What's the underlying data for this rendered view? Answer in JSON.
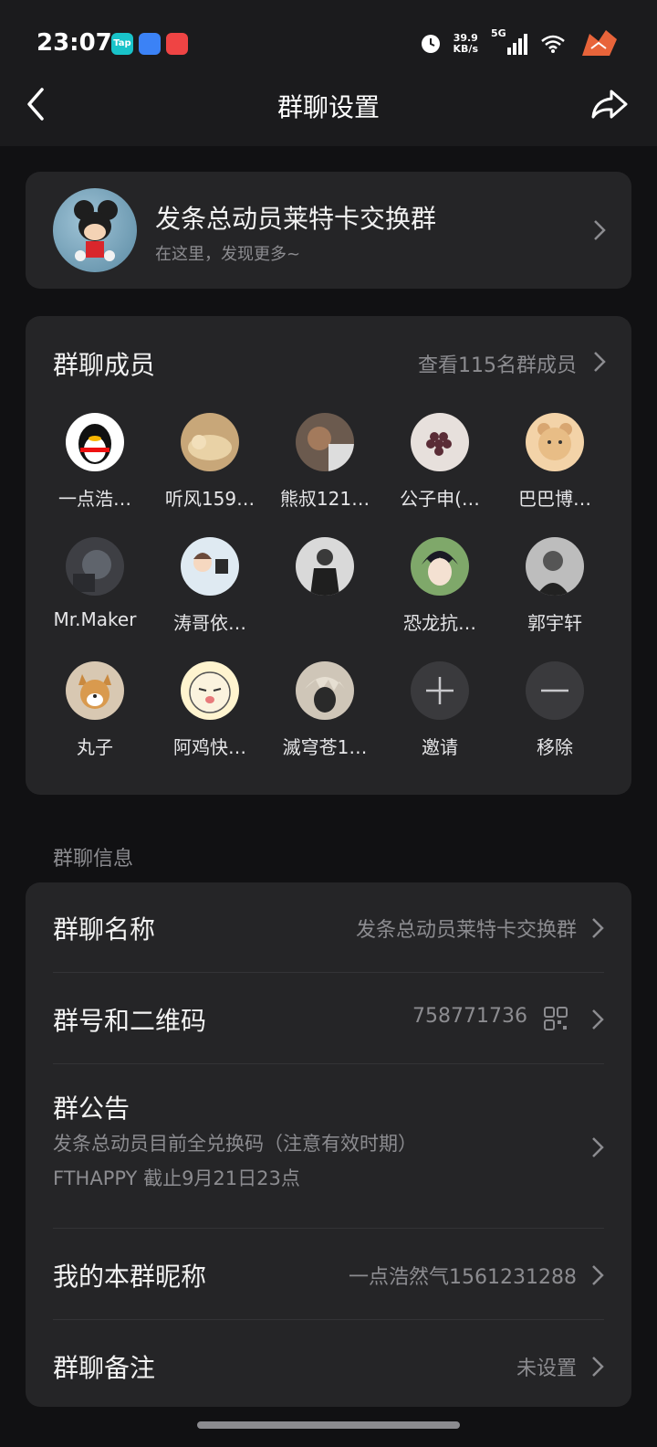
{
  "status_bar": {
    "time": "23:07",
    "apps": [
      {
        "name": "taptap-icon",
        "label": "Tap",
        "color": "#19c3c9"
      },
      {
        "name": "files-icon",
        "label": "",
        "color": "#3b82f6"
      },
      {
        "name": "red-app-icon",
        "label": "",
        "color": "#ef4444"
      }
    ],
    "speed_value": "39.9",
    "speed_unit": "KB/s",
    "network": "5G"
  },
  "nav": {
    "title": "群聊设置"
  },
  "group": {
    "name": "发条总动员莱特卡交换群",
    "subtitle": "在这里，发现更多~"
  },
  "members": {
    "title": "群聊成员",
    "view_all": "查看115名群成员",
    "items": [
      {
        "name": "一点浩…",
        "avatar": "qq-penguin",
        "color": "#ffffff"
      },
      {
        "name": "听风159…",
        "avatar": "sleeping-dog",
        "color": "#c8a779"
      },
      {
        "name": "熊叔121…",
        "avatar": "man-photo",
        "color": "#6b5a4e"
      },
      {
        "name": "公子申(…",
        "avatar": "grape-doodle",
        "color": "#e7e0dc"
      },
      {
        "name": "巴巴博…",
        "avatar": "bear-cartoon",
        "color": "#f3d3a8"
      },
      {
        "name": "Mr.Maker",
        "avatar": "dark-photo",
        "color": "#3e3f44"
      },
      {
        "name": "涛哥依…",
        "avatar": "cartoon-boy",
        "color": "#dfeaf2"
      },
      {
        "name": "",
        "avatar": "man-suit",
        "color": "#d9d9d9"
      },
      {
        "name": "恐龙抗…",
        "avatar": "anime-boy",
        "color": "#7fa86a"
      },
      {
        "name": "郭宇轩",
        "avatar": "bw-portrait",
        "color": "#bdbdbd"
      },
      {
        "name": "丸子",
        "avatar": "shiba-dog",
        "color": "#d8c8b2"
      },
      {
        "name": "阿鸡快…",
        "avatar": "cat-cartoon",
        "color": "#fff4cf"
      },
      {
        "name": "滅穹苍1…",
        "avatar": "anime-silver",
        "color": "#cfc6b8"
      }
    ],
    "invite_label": "邀请",
    "remove_label": "移除"
  },
  "info": {
    "section_label": "群聊信息",
    "name_label": "群聊名称",
    "name_value": "发条总动员莱特卡交换群",
    "number_label": "群号和二维码",
    "number_value": "758771736",
    "notice_label": "群公告",
    "notice_line1": "发条总动员目前全兑换码（注意有效时期）",
    "notice_line2": "FTHAPPY 截止9月21日23点",
    "nickname_label": "我的本群昵称",
    "nickname_value": "一点浩然气1561231288",
    "remark_label": "群聊备注",
    "remark_value": "未设置"
  }
}
